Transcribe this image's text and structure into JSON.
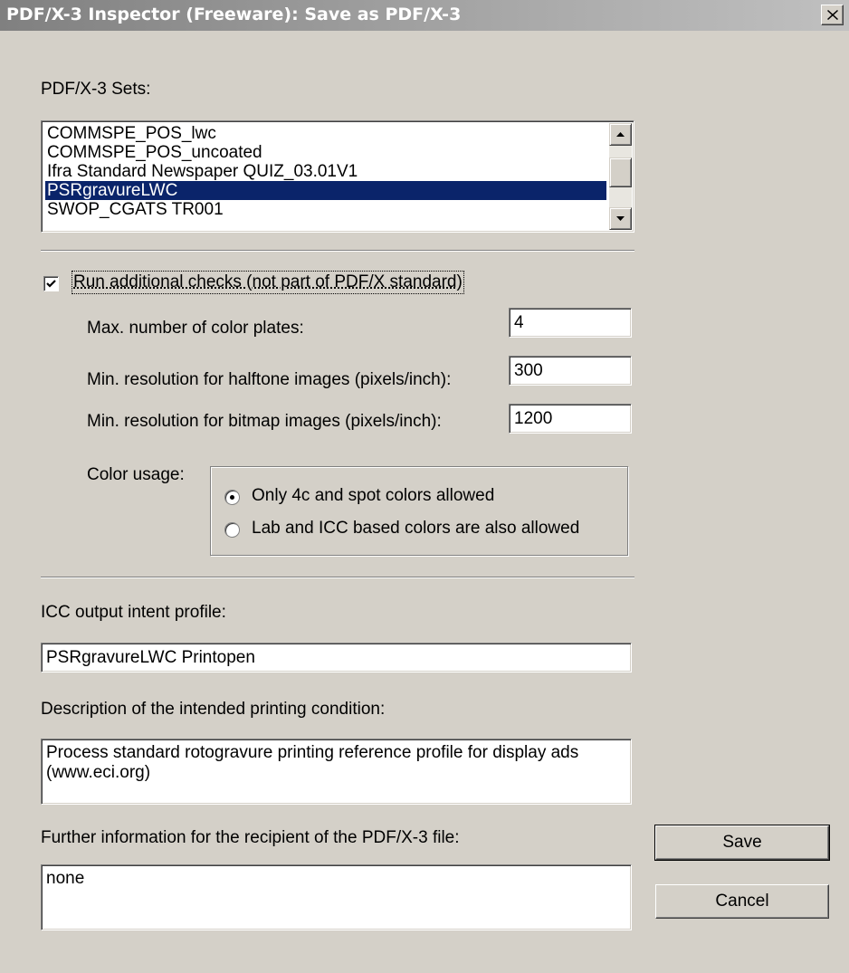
{
  "window": {
    "title": "PDF/X-3 Inspector (Freeware): Save as PDF/X-3",
    "close_icon": "close-icon"
  },
  "sets": {
    "label": "PDF/X-3 Sets:",
    "items": [
      "COMMSPE_POS_lwc",
      "COMMSPE_POS_uncoated",
      "Ifra Standard Newspaper QUIZ_03.01V1",
      "PSRgravureLWC",
      "SWOP_CGATS TR001"
    ],
    "selected": "PSRgravureLWC"
  },
  "checks": {
    "enabled": true,
    "label": "Run additional checks (not part of PDF/X standard)",
    "max_plates_label": "Max. number of color plates:",
    "max_plates_value": "4",
    "halftone_label": "Min. resolution for halftone images (pixels/inch):",
    "halftone_value": "300",
    "bitmap_label": "Min. resolution for bitmap images (pixels/inch):",
    "bitmap_value": "1200",
    "color_usage_label": "Color usage:",
    "color_options": [
      "Only 4c and spot colors allowed",
      "Lab and ICC based colors are also allowed"
    ],
    "color_selected": "Only 4c and spot colors allowed"
  },
  "output_intent": {
    "profile_label": "ICC output intent profile:",
    "profile_value": "PSRgravureLWC Printopen",
    "description_label": "Description of the intended printing condition:",
    "description_value": "Process standard rotogravure printing reference profile for display ads (www.eci.org)",
    "further_label": "Further information for the recipient of the PDF/X-3 file:",
    "further_value": "none"
  },
  "buttons": {
    "save": "Save",
    "cancel": "Cancel"
  }
}
